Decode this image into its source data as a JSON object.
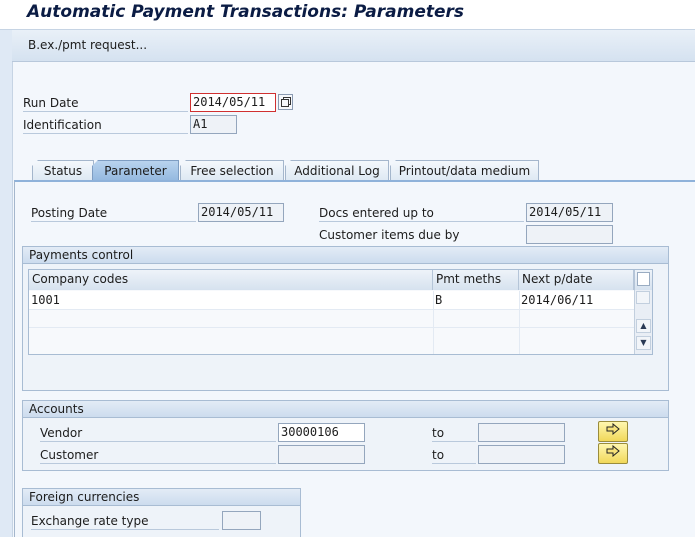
{
  "window": {
    "title": "Automatic Payment Transactions: Parameters"
  },
  "toolbar": {
    "button_label": "B.ex./pmt request..."
  },
  "header_fields": {
    "run_date_label": "Run Date",
    "run_date_value": "2014/05/11",
    "identification_label": "Identification",
    "identification_value": "A1"
  },
  "tabs": [
    {
      "label": "Status",
      "active": false
    },
    {
      "label": "Parameter",
      "active": true
    },
    {
      "label": "Free selection",
      "active": false
    },
    {
      "label": "Additional Log",
      "active": false
    },
    {
      "label": "Printout/data medium",
      "active": false
    }
  ],
  "parameter": {
    "posting_date_label": "Posting Date",
    "posting_date_value": "2014/05/11",
    "docs_entered_label": "Docs entered up to",
    "docs_entered_value": "2014/05/11",
    "customer_items_label": "Customer items due by",
    "customer_items_value": ""
  },
  "payments_control": {
    "title": "Payments control",
    "columns": [
      "Company codes",
      "Pmt meths",
      "Next p/date"
    ],
    "rows": [
      [
        "1001",
        "B",
        "2014/06/11"
      ]
    ]
  },
  "accounts": {
    "title": "Accounts",
    "vendor_label": "Vendor",
    "vendor_from": "30000106",
    "vendor_to_label": "to",
    "vendor_to": "",
    "customer_label": "Customer",
    "customer_from": "",
    "customer_to_label": "to",
    "customer_to": ""
  },
  "foreign_currencies": {
    "title": "Foreign currencies",
    "exchange_rate_label": "Exchange rate type",
    "exchange_rate_value": ""
  },
  "colors": {
    "title_text": "#0b1c44",
    "active_tab": "#93b8df",
    "go_button": "#f1d85a"
  },
  "icons": {
    "calendar": "calendar-icon",
    "multiple_selection": "multiple-selection-arrow-icon",
    "scroll_up": "scroll-up-icon",
    "scroll_down": "scroll-down-icon"
  }
}
